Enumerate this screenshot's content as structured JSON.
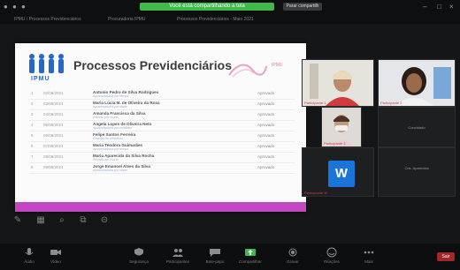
{
  "top_bar": {
    "sharing_notice": "Você está compartilhando a tela",
    "stop_share_label": "Parar compartilh",
    "tabs": [
      "IPMU / Processos Previdenciários",
      "Procuradoria IPMU",
      "Processos Previdenciários - Maio 2021"
    ]
  },
  "slide": {
    "logo_text": "IPMU",
    "title": "Processos Previdenciários",
    "pink_word": "IPMU",
    "rows": [
      {
        "num": "1",
        "date": "02/05/2021",
        "name": "Antonio Pedro de Silva Rodrigues",
        "desc": "Aposentadoria por tempo",
        "status": "Aprovado"
      },
      {
        "num": "2",
        "date": "03/05/2021",
        "name": "Maria Lúcia M. de Oliveira da Rosa",
        "desc": "Aposentadoria por idade",
        "status": "Aprovado"
      },
      {
        "num": "3",
        "date": "04/05/2021",
        "name": "Amanda Francisca da Silva",
        "desc": "Pensão por morte",
        "status": "Aprovado"
      },
      {
        "num": "4",
        "date": "05/05/2021",
        "name": "Angela Lopes de Oliveira Neto",
        "desc": "Aposentadoria por invalidez",
        "status": "Aprovado"
      },
      {
        "num": "5",
        "date": "06/05/2021",
        "name": "Felipe Santos Ferreira",
        "desc": "Revisão de benefício",
        "status": "Aprovado"
      },
      {
        "num": "6",
        "date": "07/05/2021",
        "name": "Maria Teodora Guimarães",
        "desc": "Aposentadoria por tempo",
        "status": "Aprovado"
      },
      {
        "num": "7",
        "date": "08/05/2021",
        "name": "Maria Aparecida da Silva Rocha",
        "desc": "Pensão por morte",
        "status": "Aprovado"
      },
      {
        "num": "8",
        "date": "09/05/2021",
        "name": "Jorge Emanoel Alves da Silva",
        "desc": "Aposentadoria por idade",
        "status": "Aprovado"
      }
    ]
  },
  "participants": [
    {
      "label": "Participante 1",
      "kind": "video"
    },
    {
      "label": "Participante 2",
      "kind": "video"
    },
    {
      "label": "Participante 3",
      "kind": "video"
    },
    {
      "label": "Convidado",
      "kind": "name-only"
    },
    {
      "label": "Participante W",
      "kind": "avatar",
      "initial": "W"
    },
    {
      "label": "Cris. Aparecida",
      "kind": "name-only"
    }
  ],
  "bottom_toolbar": {
    "items": [
      "Áudio",
      "Vídeo",
      "Segurança",
      "Participantes",
      "Bate-papo",
      "Compartilhar",
      "Gravar",
      "Reações",
      "Mais"
    ],
    "end_label": "Sair"
  },
  "colors": {
    "notice_green": "#3fb94a",
    "slide_footer_pink": "#c446c4",
    "logo_blue": "#2a66c6",
    "w_avatar_blue": "#1b74d9"
  }
}
